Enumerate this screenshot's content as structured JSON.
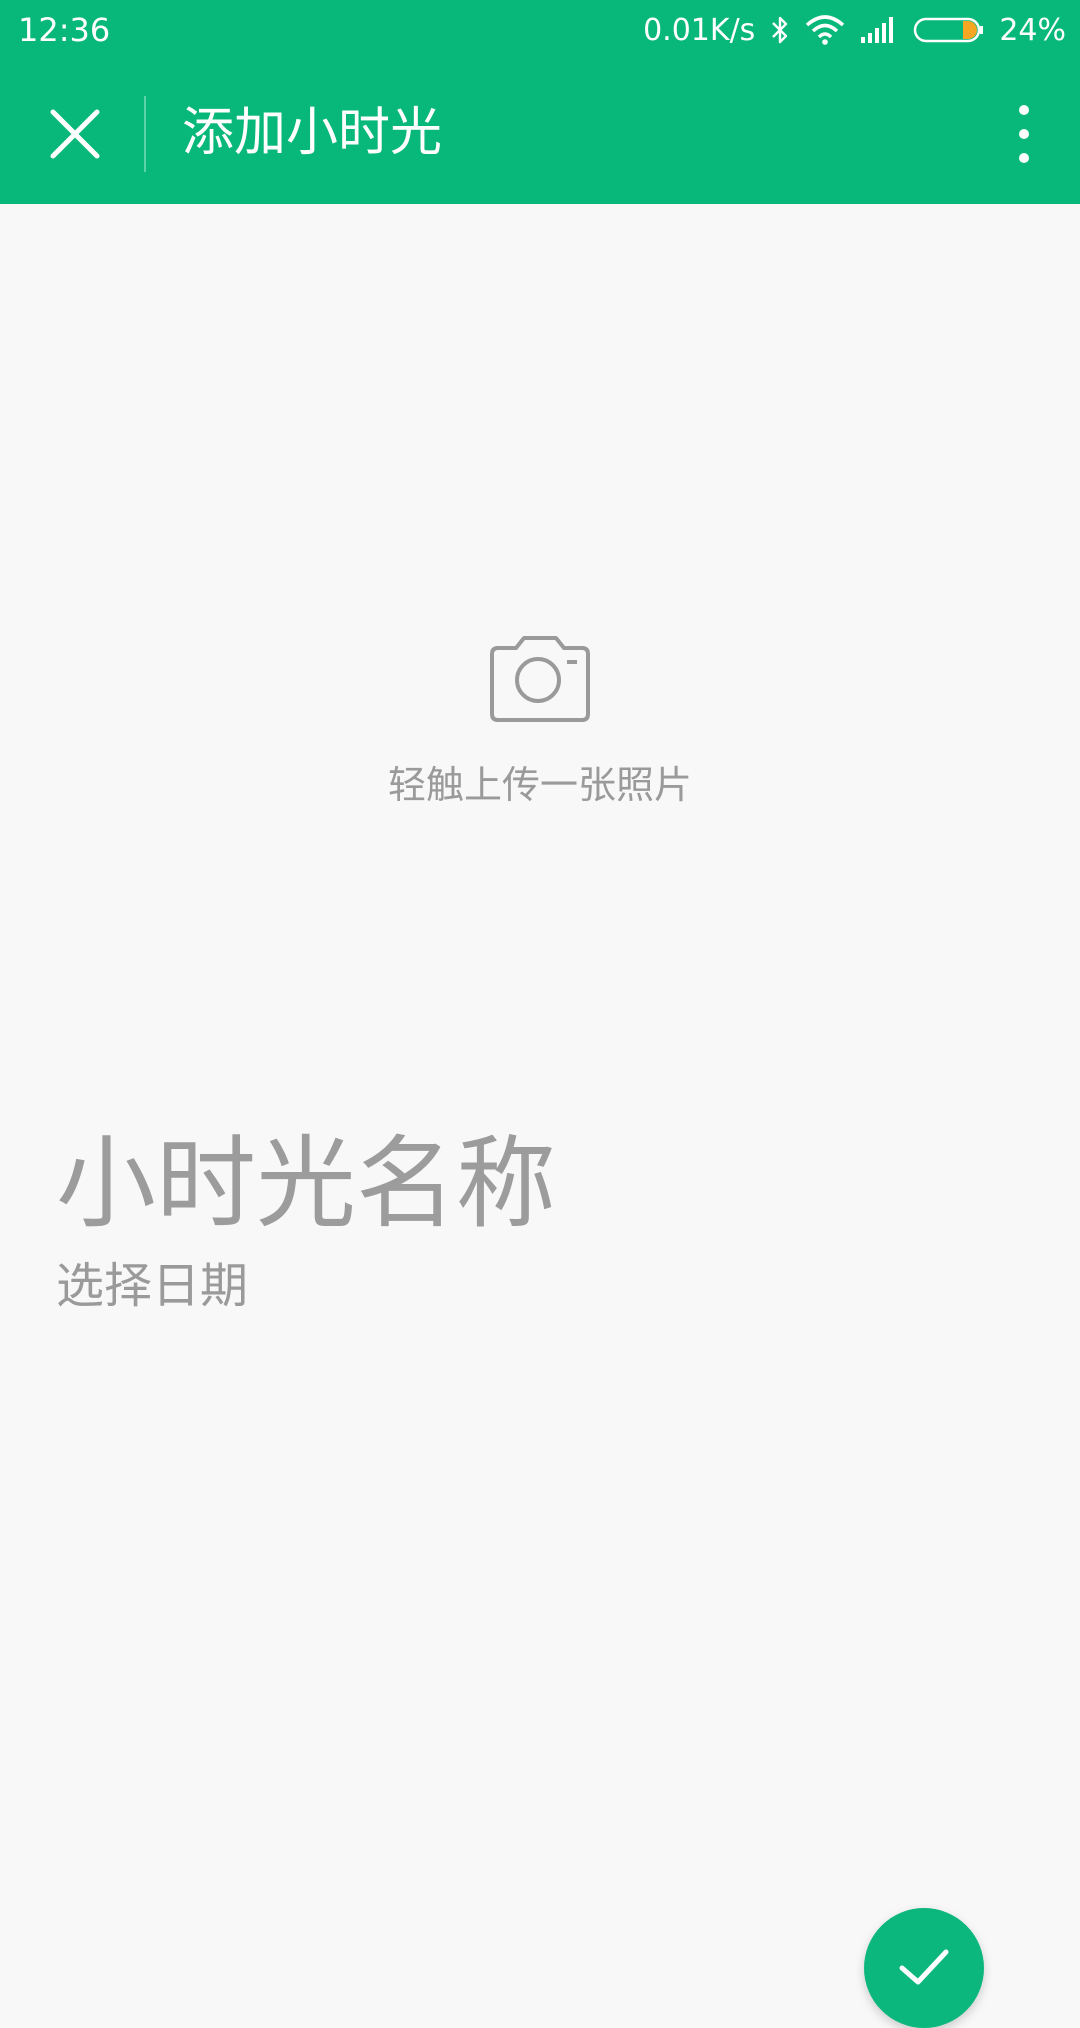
{
  "status_bar": {
    "time": "12:36",
    "network_speed": "0.01K/s",
    "battery_percent": "24%",
    "battery_level": 0.24,
    "icons": [
      "bluetooth-icon",
      "wifi-icon",
      "signal-icon",
      "battery-icon"
    ]
  },
  "app_bar": {
    "title": "添加小时光",
    "close_icon": "close-icon",
    "more_icon": "more-vert-icon"
  },
  "upload": {
    "icon": "camera-icon",
    "hint": "轻触上传一张照片"
  },
  "form": {
    "name_placeholder": "小时光名称",
    "date_label": "选择日期"
  },
  "fab": {
    "icon": "check-icon"
  },
  "colors": {
    "primary": "#07b87a",
    "background": "#f8f8f8",
    "hint_text": "#9a9a9a",
    "battery_fill": "#f5a623"
  }
}
